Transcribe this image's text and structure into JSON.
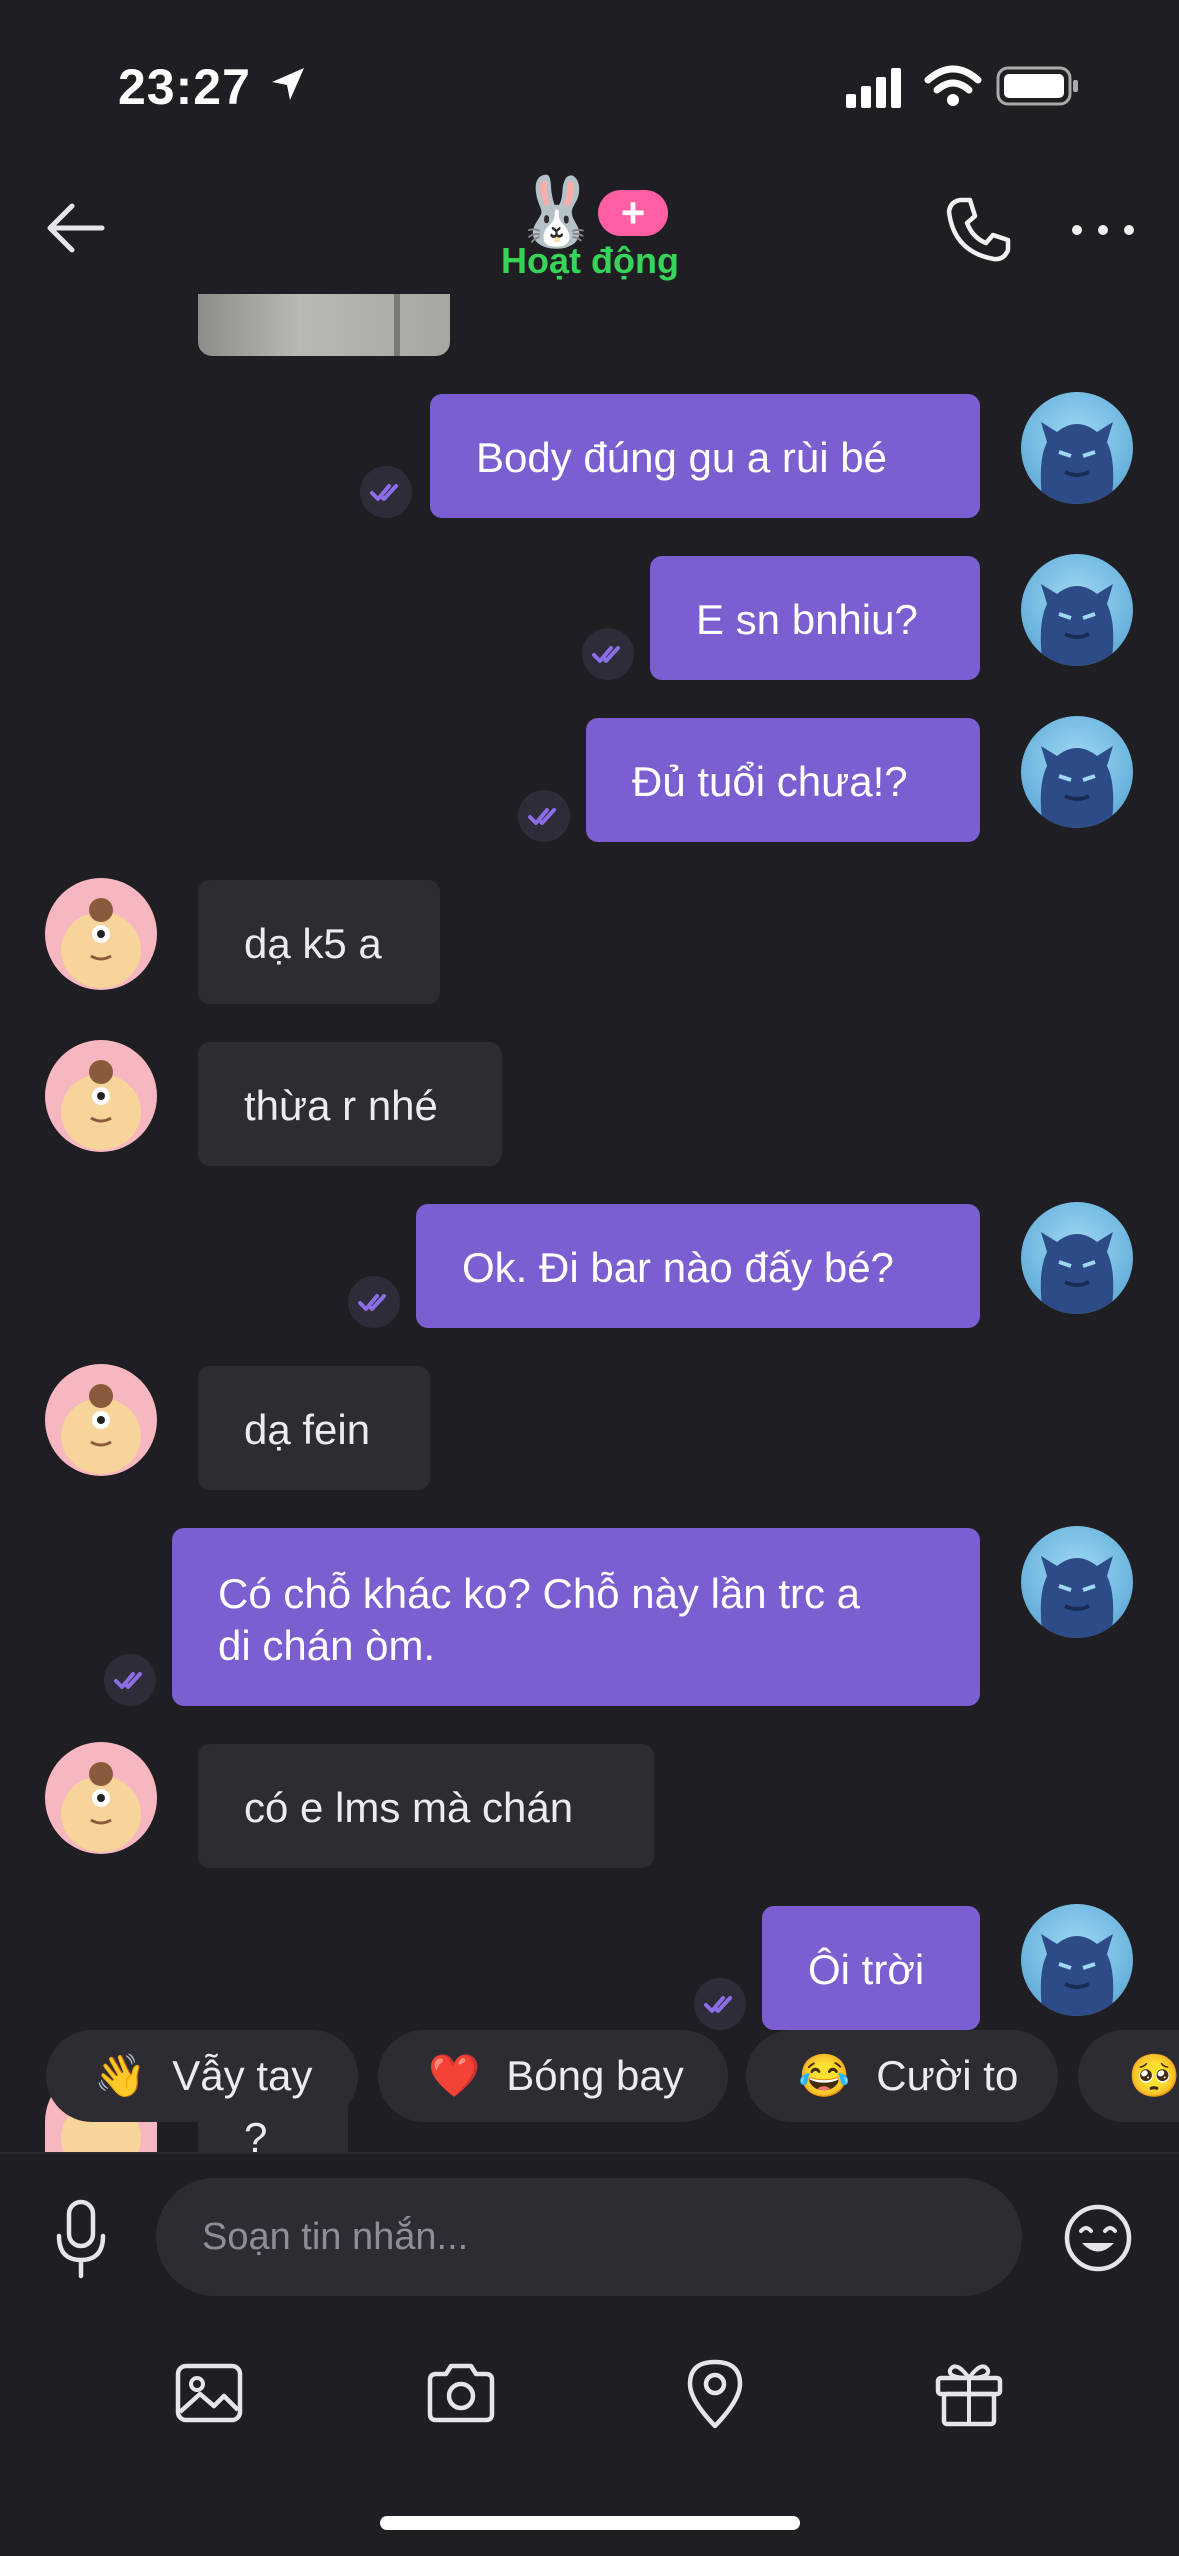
{
  "status_bar": {
    "time": "23:27"
  },
  "header": {
    "emoji": "🐰",
    "badge": "+",
    "status": "Hoạt động",
    "status_color": "#37d45a",
    "icons": [
      "back-arrow-icon",
      "phone-icon",
      "more-icon"
    ]
  },
  "messages": [
    {
      "side": "out",
      "text": "Body đúng gu a rùi bé"
    },
    {
      "side": "out",
      "text": "E sn bnhiu?"
    },
    {
      "side": "out",
      "text": "Đủ tuổi chưa!?"
    },
    {
      "side": "in",
      "text": "dạ k5 a"
    },
    {
      "side": "in",
      "text": "thừa r nhé"
    },
    {
      "side": "out",
      "text": "Ok. Đi bar nào đấy bé?"
    },
    {
      "side": "in",
      "text": "dạ fein"
    },
    {
      "side": "out",
      "text": "Có chỗ khác ko? Chỗ này lần trc a",
      "text2": "di chán òm."
    },
    {
      "side": "in",
      "text": "có e lms mà chán"
    },
    {
      "side": "out",
      "text": "Ôi trời"
    },
    {
      "side": "in",
      "text": "?"
    }
  ],
  "quick_reactions": [
    {
      "emoji": "👋",
      "label": "Vẫy tay"
    },
    {
      "emoji": "❤️",
      "label": "Bóng bay"
    },
    {
      "emoji": "😂",
      "label": "Cười to"
    },
    {
      "emoji": "🥺",
      "label": ""
    }
  ],
  "composer": {
    "placeholder": "Soạn tin nhắn..."
  },
  "toolbar": [
    "image-icon",
    "camera-icon",
    "location-icon",
    "gift-icon"
  ],
  "colors": {
    "background": "#1f1e23",
    "outgoing_bubble": "#7b5fd1",
    "incoming_bubble": "#2d2c32",
    "badge": "#ff5fa2"
  }
}
